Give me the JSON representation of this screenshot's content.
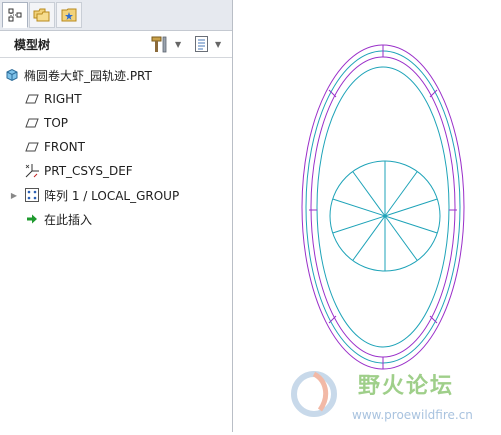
{
  "tabs": [
    {
      "name": "model-tree-tab",
      "icon": "tree-structure-icon",
      "active": true
    },
    {
      "name": "folder-browser-tab",
      "icon": "folder-icon",
      "active": false
    },
    {
      "name": "favorites-tab",
      "icon": "favorites-icon",
      "active": false
    }
  ],
  "header": {
    "title": "模型树",
    "settings_icon": "hammer-icon",
    "show_icon": "list-settings-icon"
  },
  "tree": {
    "items": [
      {
        "label": "椭圆卷大虾_园轨迹.PRT",
        "icon": "part-icon",
        "expander": ""
      },
      {
        "label": "RIGHT",
        "icon": "datum-plane-icon",
        "expander": ""
      },
      {
        "label": "TOP",
        "icon": "datum-plane-icon",
        "expander": ""
      },
      {
        "label": "FRONT",
        "icon": "datum-plane-icon",
        "expander": ""
      },
      {
        "label": "PRT_CSYS_DEF",
        "icon": "coordinate-system-icon",
        "expander": ""
      },
      {
        "label": "阵列 1 / LOCAL_GROUP",
        "icon": "pattern-icon",
        "expander": "▶"
      },
      {
        "label": "在此插入",
        "icon": "insert-here-arrow-icon",
        "expander": ""
      }
    ]
  },
  "colors": {
    "outer_curve": "#9a2fc9",
    "inner_curve": "#1ea3b8",
    "insert_arrow": "#1e9a2e"
  },
  "watermark": {
    "logo_icon": "proewildfire-logo-icon",
    "title": "野火论坛",
    "url": "www.proewildfire.cn"
  }
}
